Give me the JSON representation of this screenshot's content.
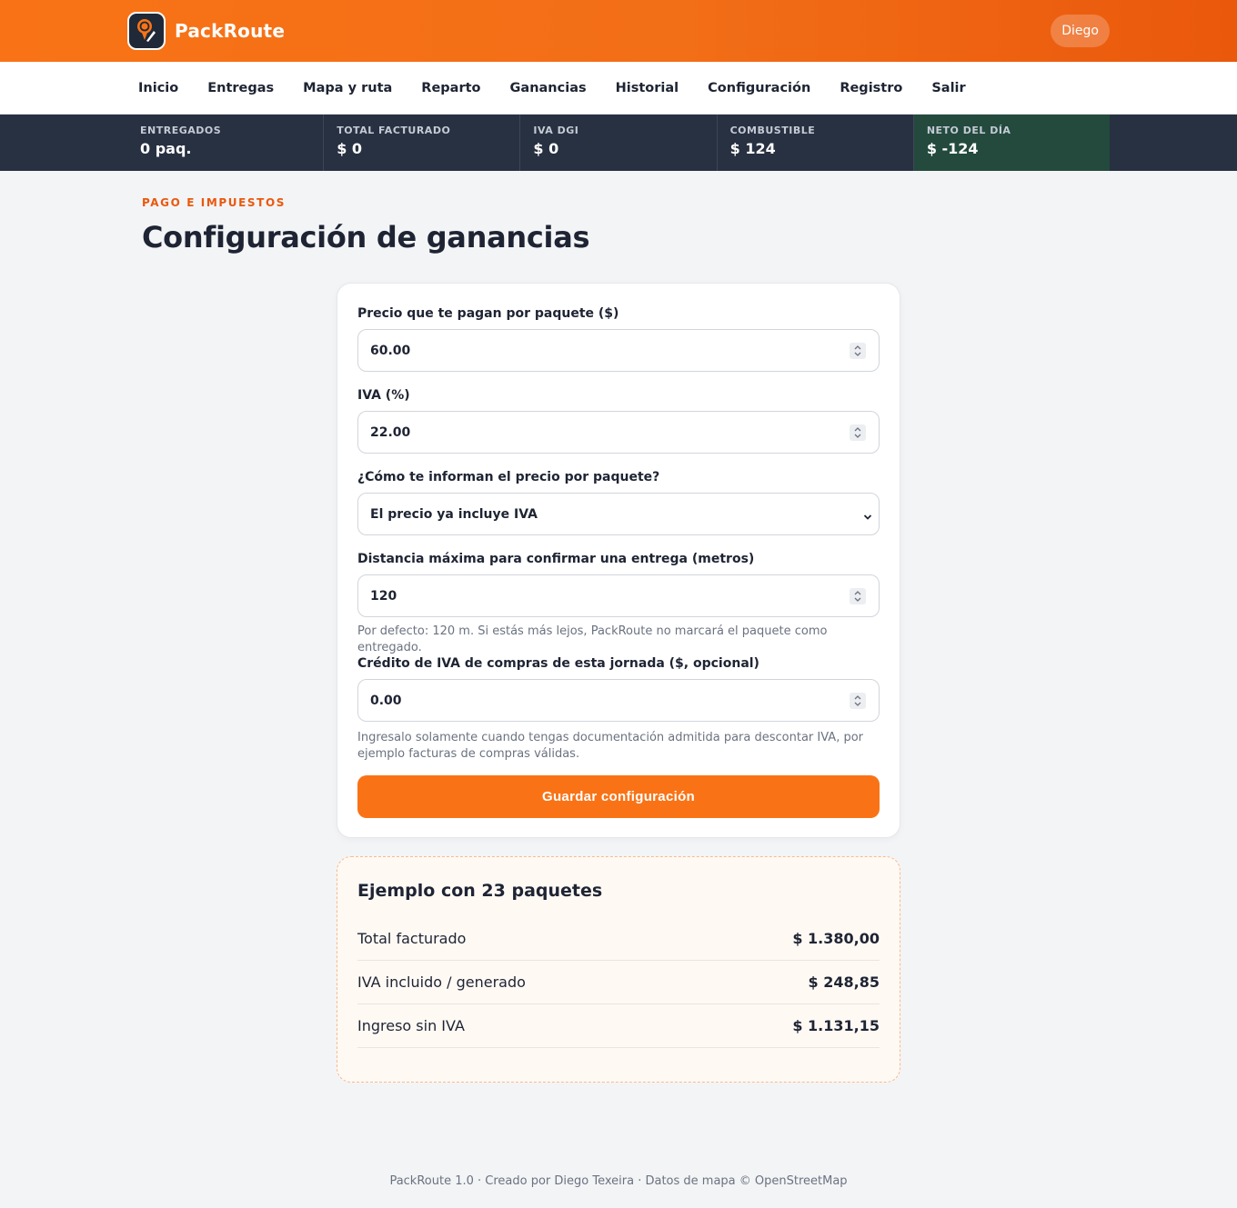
{
  "app": {
    "name": "PackRoute"
  },
  "user": {
    "name": "Diego"
  },
  "nav": {
    "items": [
      "Inicio",
      "Entregas",
      "Mapa y ruta",
      "Reparto",
      "Ganancias",
      "Historial",
      "Configuración",
      "Registro",
      "Salir"
    ]
  },
  "stats": [
    {
      "label": "ENTREGADOS",
      "value": "0 paq."
    },
    {
      "label": "TOTAL FACTURADO",
      "value": "$ 0"
    },
    {
      "label": "IVA DGI",
      "value": "$ 0"
    },
    {
      "label": "COMBUSTIBLE",
      "value": "$ 124"
    },
    {
      "label": "NETO DEL DÍA",
      "value": "$ -124"
    }
  ],
  "page": {
    "eyebrow": "PAGO E IMPUESTOS",
    "title": "Configuración de ganancias"
  },
  "form": {
    "price": {
      "label": "Precio que te pagan por paquete ($)",
      "value": "60.00"
    },
    "iva": {
      "label": "IVA (%)",
      "value": "22.00"
    },
    "price_mode": {
      "label": "¿Cómo te informan el precio por paquete?",
      "value": "El precio ya incluye IVA"
    },
    "distance": {
      "label": "Distancia máxima para confirmar una entrega (metros)",
      "value": "120",
      "hint": "Por defecto: 120 m. Si estás más lejos, PackRoute no marcará el paquete como entregado."
    },
    "credit": {
      "label": "Crédito de IVA de compras de esta jornada ($, opcional)",
      "value": "0.00",
      "hint": "Ingresalo solamente cuando tengas documentación admitida para descontar IVA, por ejemplo facturas de compras válidas."
    },
    "save_label": "Guardar configuración"
  },
  "example": {
    "title": "Ejemplo con 23 paquetes",
    "rows": [
      {
        "label": "Total facturado",
        "value": "$ 1.380,00"
      },
      {
        "label": "IVA incluido / generado",
        "value": "$ 248,85"
      },
      {
        "label": "Ingreso sin IVA",
        "value": "$ 1.131,15"
      }
    ]
  },
  "footer": {
    "text": "PackRoute 1.0 · Creado por Diego Texeira · Datos de mapa © OpenStreetMap"
  },
  "colors": {
    "accent": "#f97316",
    "stats_bg": "#283141",
    "net_bg": "#234a3d"
  }
}
